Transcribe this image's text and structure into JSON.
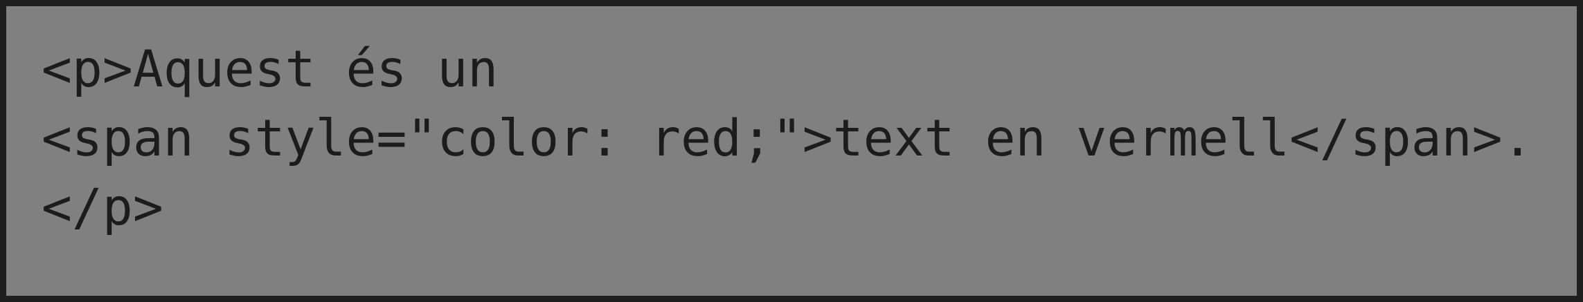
{
  "code": {
    "lines": [
      "<p>Aquest és un",
      "<span style=\"color: red;\">text en vermell</span>.",
      "</p>"
    ]
  },
  "colors": {
    "background": "#808080",
    "border": "#1f1f1f",
    "text": "#1c1c1c"
  }
}
